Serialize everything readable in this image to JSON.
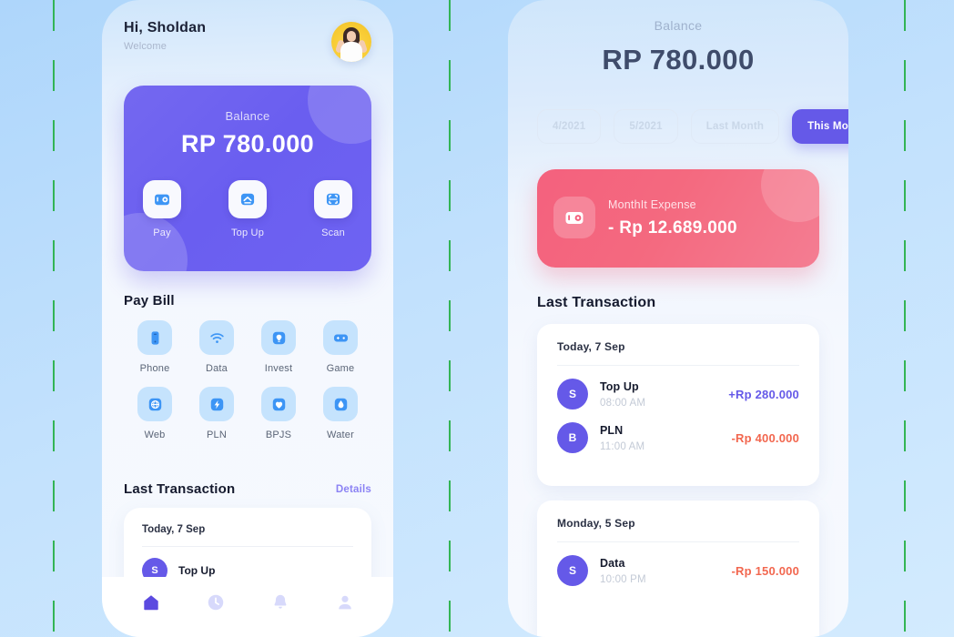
{
  "background": {
    "gradient_from": "#aed6fb",
    "gradient_to": "#d3ebfe",
    "guide_color": "#2bb24c",
    "guide_positions": [
      58,
      493,
      993
    ]
  },
  "colors": {
    "primary": "#6559e8",
    "primary_light": "#7468f0",
    "expense_red": "#f4617e",
    "amount_positive": "#6559e8",
    "amount_negative": "#f2674f",
    "bill_icon_bg": "#c5e3fd",
    "bill_icon_fg": "#2f8bf5"
  },
  "home_screen": {
    "header": {
      "greeting": "Hi, Sholdan",
      "subtitle": "Welcome",
      "avatar_name": "avatar"
    },
    "balance_card": {
      "label": "Balance",
      "amount": "RP 780.000",
      "actions": [
        {
          "icon": "wallet-icon",
          "label": "Pay"
        },
        {
          "icon": "topup-icon",
          "label": "Top Up"
        },
        {
          "icon": "scan-icon",
          "label": "Scan"
        }
      ]
    },
    "pay_bill": {
      "title": "Pay Bill",
      "items": [
        {
          "icon": "phone-icon",
          "label": "Phone"
        },
        {
          "icon": "wifi-icon",
          "label": "Data"
        },
        {
          "icon": "invest-icon",
          "label": "Invest"
        },
        {
          "icon": "gamepad-icon",
          "label": "Game"
        },
        {
          "icon": "globe-icon",
          "label": "Web"
        },
        {
          "icon": "bolt-icon",
          "label": "PLN"
        },
        {
          "icon": "heart-icon",
          "label": "BPJS"
        },
        {
          "icon": "water-drop-icon",
          "label": "Water"
        }
      ]
    },
    "last_transaction": {
      "title": "Last Transaction",
      "details_label": "Details",
      "date": "Today, 7 Sep",
      "first_item": {
        "initial": "S",
        "name": "Top Up"
      }
    },
    "bottom_nav": [
      {
        "icon": "home-icon",
        "active": true
      },
      {
        "icon": "clock-icon",
        "active": false
      },
      {
        "icon": "bell-icon",
        "active": false
      },
      {
        "icon": "person-icon",
        "active": false
      }
    ]
  },
  "detail_screen": {
    "balance": {
      "label": "Balance",
      "amount": "RP 780.000"
    },
    "filters": [
      {
        "label": "4/2021",
        "active": false
      },
      {
        "label": "5/2021",
        "active": false
      },
      {
        "label": "Last Month",
        "active": false
      },
      {
        "label": "This Month",
        "active": true
      }
    ],
    "expense_card": {
      "icon": "wallet-icon",
      "label": "MonthIt Expense",
      "amount": "- Rp 12.689.000"
    },
    "last_transaction": {
      "title": "Last Transaction",
      "groups": [
        {
          "date": "Today, 7 Sep",
          "rows": [
            {
              "initial": "S",
              "name": "Top Up",
              "time": "08:00 AM",
              "amount": "+Rp 280.000",
              "sign": "pos"
            },
            {
              "initial": "B",
              "name": "PLN",
              "time": "11:00 AM",
              "amount": "-Rp 400.000",
              "sign": "neg"
            }
          ]
        },
        {
          "date": "Monday, 5 Sep",
          "rows": [
            {
              "initial": "S",
              "name": "Data",
              "time": "10:00 PM",
              "amount": "-Rp 150.000",
              "sign": "neg"
            }
          ]
        }
      ]
    }
  }
}
